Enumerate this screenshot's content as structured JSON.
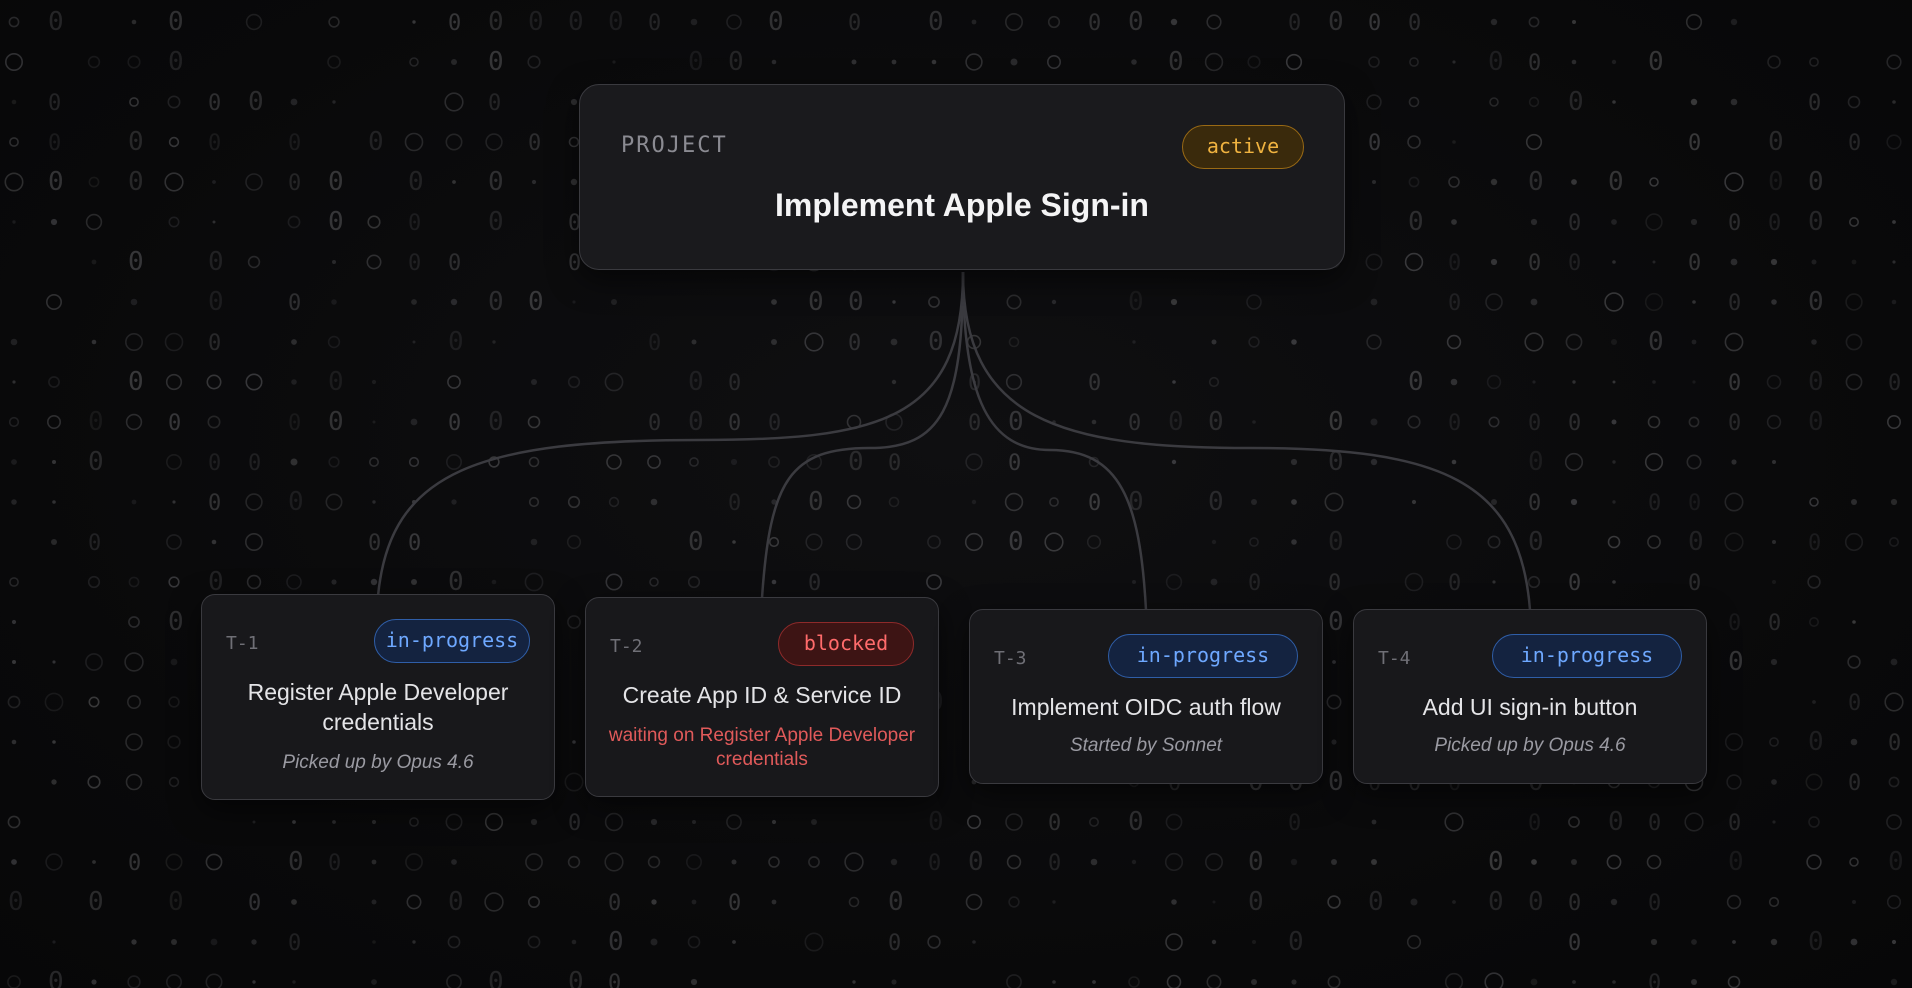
{
  "project": {
    "label": "PROJECT",
    "title": "Implement Apple Sign-in",
    "status": "active"
  },
  "tasks": [
    {
      "id": "T-1",
      "status": "in-progress",
      "title": "Register Apple Developer credentials",
      "note": "Picked up by Opus 4.6"
    },
    {
      "id": "T-2",
      "status": "blocked",
      "title": "Create App ID & Service ID",
      "note": "waiting on Register Apple Developer credentials"
    },
    {
      "id": "T-3",
      "status": "in-progress",
      "title": "Implement OIDC auth flow",
      "note": "Started by Sonnet"
    },
    {
      "id": "T-4",
      "status": "in-progress",
      "title": "Add UI sign-in button",
      "note": "Picked up by Opus 4.6"
    }
  ],
  "colors": {
    "active": "#f0b340",
    "in_progress": "#6ea8ff",
    "blocked": "#ff6b6b",
    "edge": "#3b3b40"
  }
}
